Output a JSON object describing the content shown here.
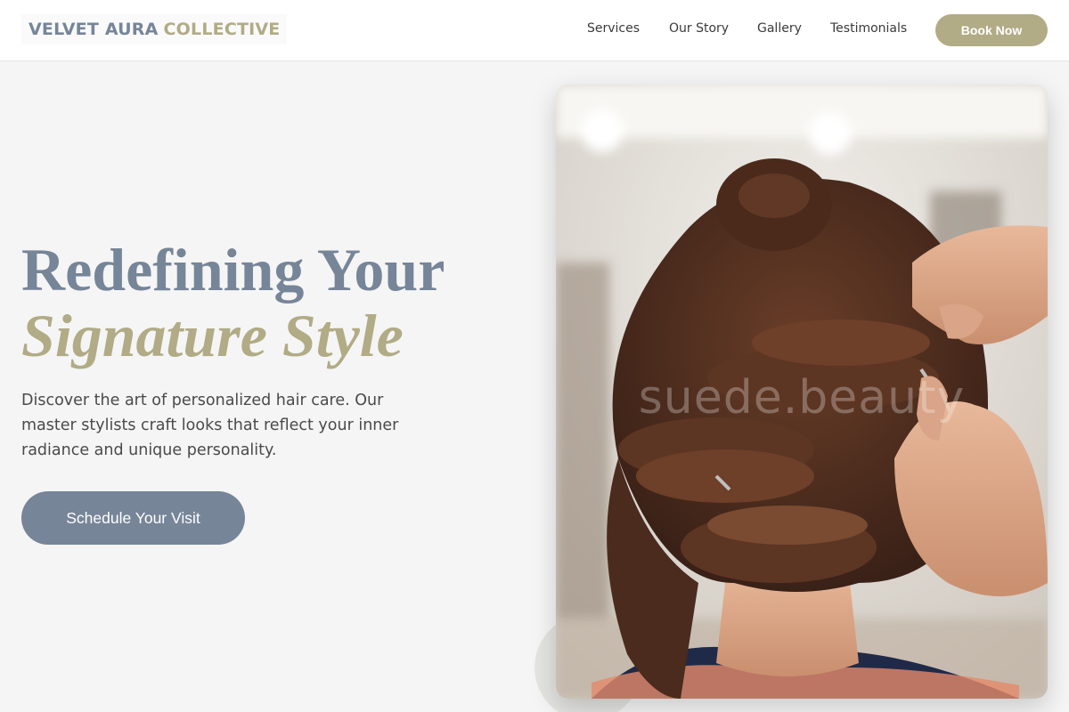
{
  "brand": {
    "part1": "VELVET AURA",
    "part2": "COLLECTIVE"
  },
  "nav": {
    "links": [
      "Services",
      "Our Story",
      "Gallery",
      "Testimonials"
    ],
    "cta": "Book Now"
  },
  "hero": {
    "title_line1": "Redefining Your",
    "title_line2": "Signature Style",
    "description": "Discover the art of personalized hair care. Our master stylists craft looks that reflect your inner radiance and unique personality.",
    "cta": "Schedule Your Visit"
  },
  "image": {
    "watermark": "suede.beauty"
  },
  "colors": {
    "slate": "#768598",
    "gold": "#b1ab86",
    "background": "#f5f5f5"
  }
}
